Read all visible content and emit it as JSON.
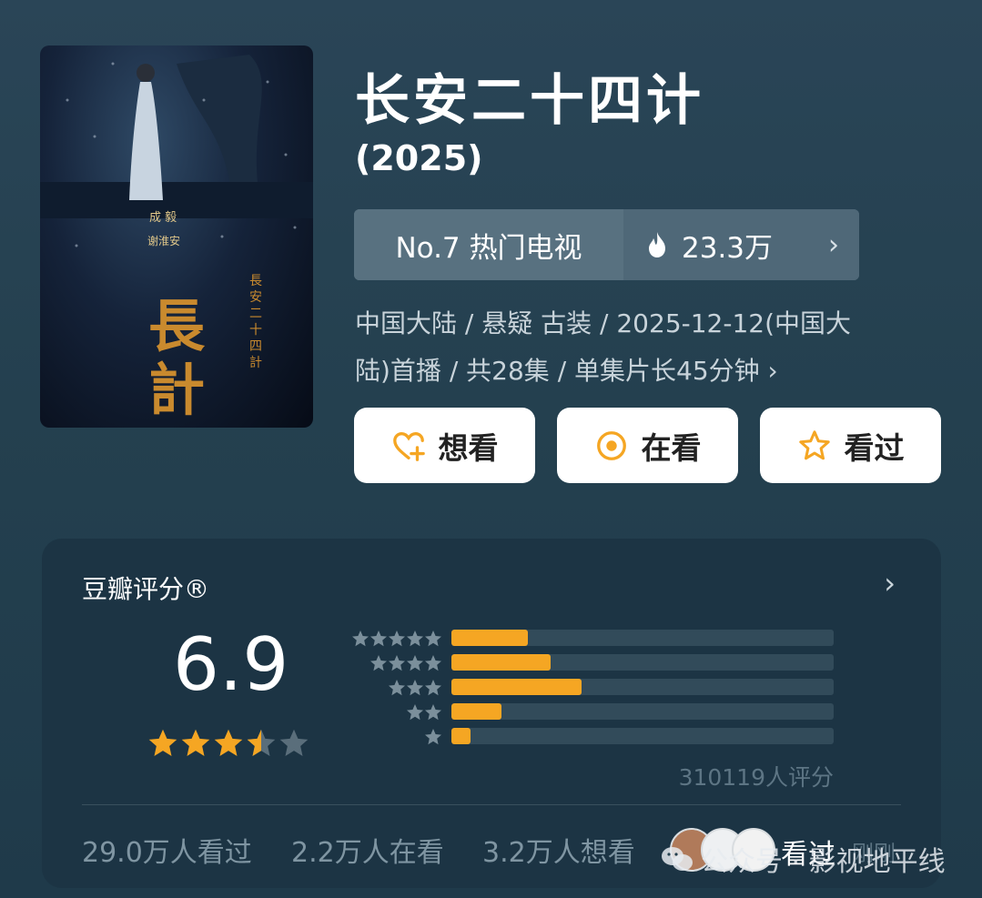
{
  "movie": {
    "title": "长安二十四计",
    "year": "(2025)",
    "rank_label": "No.7 热门电视",
    "heat_value": "23.3万",
    "meta_line1": "中国大陆 / 悬疑 古装 / 2025-12-12(中国大",
    "meta_line2": "陆)首播 / 共28集 / 单集片长45分钟 ›"
  },
  "poster": {
    "cast": "成 毅",
    "role": "谢淮安",
    "art_title": "長安二十四計"
  },
  "actions": [
    {
      "label": "想看",
      "icon": "heart-plus-icon"
    },
    {
      "label": "在看",
      "icon": "target-circle-icon"
    },
    {
      "label": "看过",
      "icon": "star-outline-icon"
    }
  ],
  "rating": {
    "heading": "豆瓣评分®",
    "score": "6.9",
    "stars_value": 3.5,
    "distribution": [
      {
        "stars": 5,
        "percent": 20
      },
      {
        "stars": 4,
        "percent": 26
      },
      {
        "stars": 3,
        "percent": 34
      },
      {
        "stars": 2,
        "percent": 13
      },
      {
        "stars": 1,
        "percent": 5
      }
    ],
    "count_label": "310119人评分"
  },
  "footer": {
    "watched": "29.0万人看过",
    "watching": "2.2万人在看",
    "want": "3.2万人想看",
    "recent_label": "看过",
    "recent_time": "刚刚"
  },
  "watermark": "公众号 · 影视地平线",
  "colors": {
    "accent": "#f5a623",
    "background": "#24404f",
    "card": "#1c3444"
  }
}
